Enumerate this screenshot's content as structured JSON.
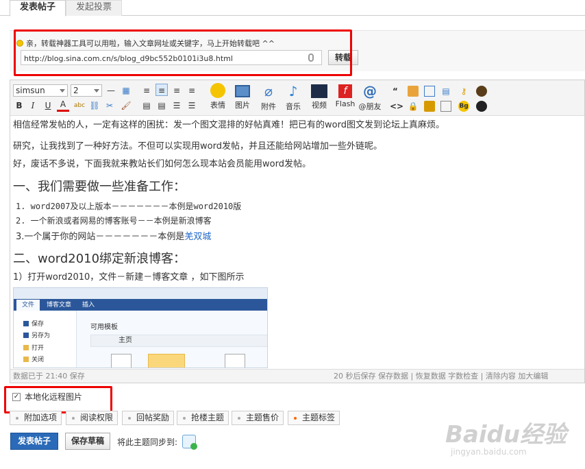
{
  "tabs": [
    {
      "label": "发表帖子",
      "active": true
    },
    {
      "label": "发起投票",
      "active": false
    }
  ],
  "repost": {
    "hint": "亲，转载神器工具可以用啦，输入文章网址或关键字，马上开始转载吧 ^^",
    "url_value": "http://blog.sina.com.cn/s/blog_d9bc552b0101i3u8.html",
    "button": "转载"
  },
  "toolbar": {
    "font_family": "simsun",
    "font_size": "2",
    "buttons": [
      {
        "label": "表情",
        "icon": "smiley-icon"
      },
      {
        "label": "图片",
        "icon": "image-icon"
      },
      {
        "label": "附件",
        "icon": "paperclip-icon"
      },
      {
        "label": "音乐",
        "icon": "music-note-icon"
      },
      {
        "label": "视频",
        "icon": "film-icon"
      },
      {
        "label": "Flash",
        "icon": "flash-icon"
      },
      {
        "label": "@朋友",
        "icon": "at-icon"
      }
    ]
  },
  "content": {
    "p1": "相信经常发帖的人，一定有这样的困扰：发一个图文混排的好帖真难！把已有的word图文发到论坛上真麻烦。",
    "p2": "研究，让我找到了一种好方法。不但可以实现用word发帖，并且还能给网站增加一些外链呢。",
    "p3": "好，废话不多说，下面我就来教站长们如何怎么现本站会员能用word发帖。",
    "h1": "一、我们需要做一些准备工作：",
    "list": [
      "1.  word2007及以上版本－－－－－－－本例是word2010版",
      "2.  一个新浪或者网易的博客账号－－本例是新浪博客",
      "3.一个属于你的网站－－－－－－－本例是"
    ],
    "link_text": "羌双城",
    "h2": "二、word2010绑定新浪博客：",
    "p4": "1）打开word2010，文件－新建－博客文章 ，如下图所示",
    "embed": {
      "tabs": [
        "文件",
        "博客文章",
        "插入"
      ],
      "side_items": [
        "保存",
        "另存为",
        "打开",
        "关闭"
      ],
      "panel_title": "可用模板",
      "home": "主页"
    }
  },
  "status": {
    "left": "数据已于 21:40 保存",
    "right": "20 秒后保存 保存数据 | 恢复数据    字数检查 | 清除内容    加大编辑"
  },
  "local_images": {
    "label": "本地化远程图片",
    "checked": true
  },
  "options": [
    "附加选项",
    "阅读权限",
    "回帖奖励",
    "抢楼主题",
    "主题售价",
    "主题标签"
  ],
  "actions": {
    "submit": "发表帖子",
    "draft": "保存草稿",
    "sync_label": "将此主题同步到:"
  },
  "watermark": {
    "main": "Baidu经验",
    "sub": "jingyan.baidu.com"
  }
}
